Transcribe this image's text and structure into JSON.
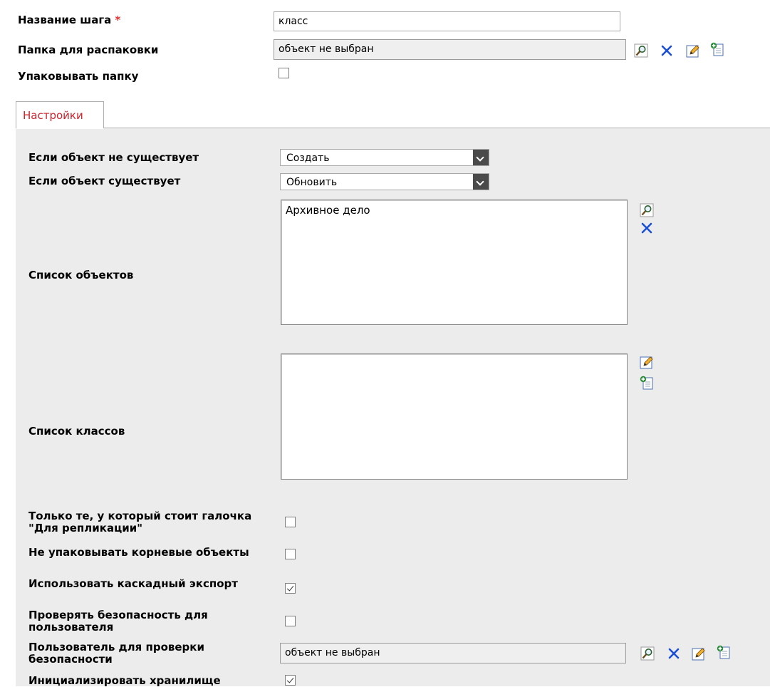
{
  "step": {
    "name_label": "Название шага",
    "required_mark": "*",
    "name_value": "класс",
    "folder_label": "Папка для распаковки",
    "folder_value": "объект не выбран",
    "pack_label": "Упаковывать папку",
    "pack_checked": false
  },
  "tabs": [
    {
      "label": "Настройки",
      "active": true
    }
  ],
  "settings": {
    "if_not_exists_label": "Если объект не существует",
    "if_not_exists_value": "Создать",
    "if_exists_label": "Если объект существует",
    "if_exists_value": "Обновить",
    "objects_label": "Список объектов",
    "objects_items": [
      "Архивное дело"
    ],
    "classes_label": "Список классов",
    "classes_items": [],
    "replication_only_label": "Только те, у который стоит галочка \"Для репликации\"",
    "replication_only_checked": false,
    "no_pack_root_label": "Не упаковывать корневые объекты",
    "no_pack_root_checked": false,
    "cascade_export_label": "Использовать каскадный экспорт",
    "cascade_export_checked": true,
    "check_security_label": "Проверять безопасность для пользователя",
    "check_security_checked": false,
    "security_user_label": "Пользователь для проверки безопасности",
    "security_user_value": "объект не выбран",
    "init_storage_label": "Инициализировать хранилище",
    "init_storage_checked": true
  },
  "icons": {
    "select": "magnifier-icon",
    "clear": "close-x-icon",
    "edit": "pencil-icon",
    "create": "new-document-icon"
  },
  "colors": {
    "required": "#e03030",
    "tab_text": "#d0202a",
    "panel_bg": "#ececec",
    "icon_blue": "#1b4fd6"
  }
}
